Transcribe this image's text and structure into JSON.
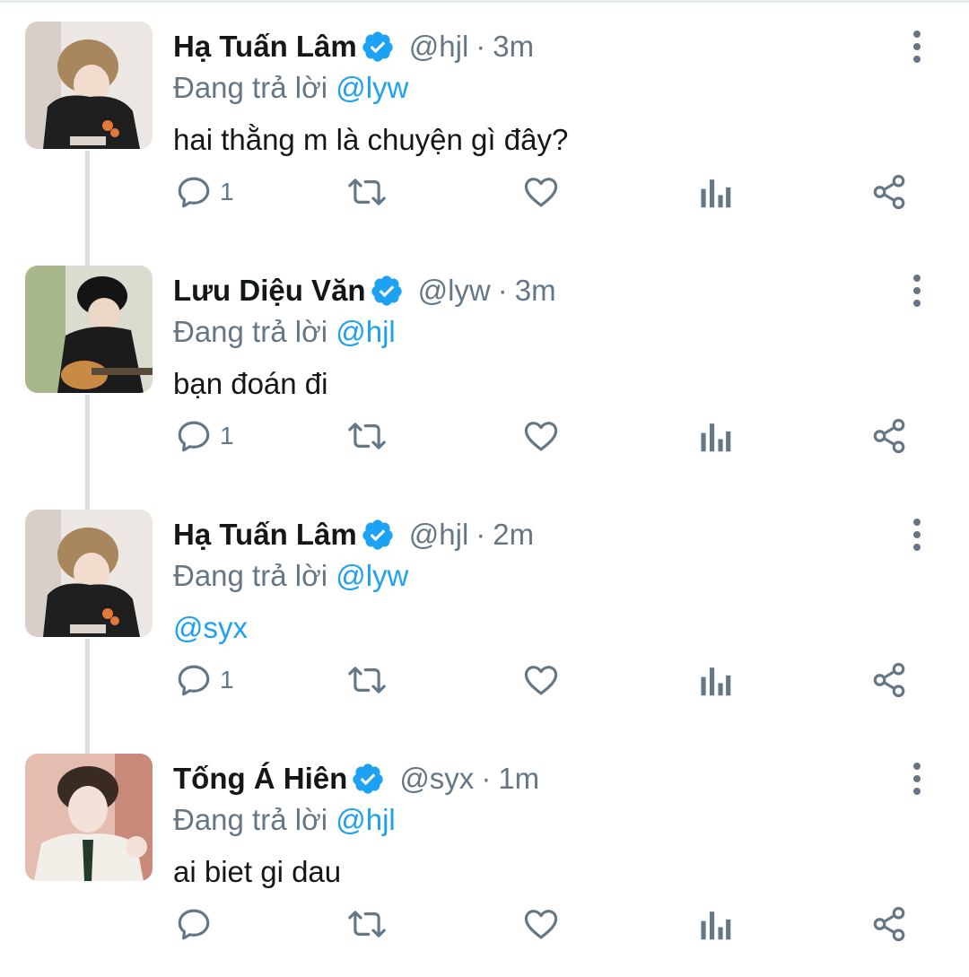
{
  "reply_prefix": "Đang trả lời",
  "colors": {
    "link": "#1da1f2",
    "verified": "#1da1f2",
    "muted": "#657786",
    "text": "#14171a"
  },
  "tweets": [
    {
      "name": "Hạ Tuấn Lâm",
      "handle": "@hjl",
      "separator": "·",
      "time": "3m",
      "reply_to": "@lyw",
      "text": "hai thằng m là chuyện gì đây?",
      "reply_count": "1",
      "avatar": "avatar-hjl"
    },
    {
      "name": "Lưu Diệu Văn",
      "handle": "@lyw",
      "separator": "·",
      "time": "3m",
      "reply_to": "@hjl",
      "text": "bạn đoán đi",
      "reply_count": "1",
      "avatar": "avatar-lyw"
    },
    {
      "name": "Hạ Tuấn Lâm",
      "handle": "@hjl",
      "separator": "·",
      "time": "2m",
      "reply_to": "@lyw",
      "text": "@syx",
      "reply_count": "1",
      "avatar": "avatar-hjl"
    },
    {
      "name": "Tống Á Hiên",
      "handle": "@syx",
      "separator": "·",
      "time": "1m",
      "reply_to": "@hjl",
      "text": "ai biet gi dau",
      "reply_count": "",
      "avatar": "avatar-syx"
    }
  ],
  "icons": [
    "reply-icon",
    "retweet-icon",
    "like-icon",
    "analytics-icon",
    "share-icon",
    "more-icon",
    "verified-badge-icon"
  ]
}
